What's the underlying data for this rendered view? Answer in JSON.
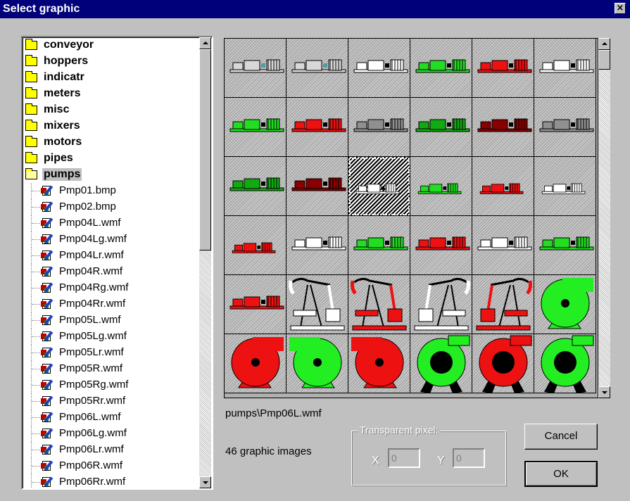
{
  "window": {
    "title": "Select graphic",
    "close_glyph": "×"
  },
  "tree": {
    "folders": [
      {
        "name": "conveyor",
        "open": false
      },
      {
        "name": "hoppers",
        "open": false
      },
      {
        "name": "indicatr",
        "open": false
      },
      {
        "name": "meters",
        "open": false
      },
      {
        "name": "misc",
        "open": false
      },
      {
        "name": "mixers",
        "open": false
      },
      {
        "name": "motors",
        "open": false
      },
      {
        "name": "pipes",
        "open": false
      },
      {
        "name": "pumps",
        "open": true,
        "selected": true
      }
    ],
    "files": [
      "Pmp01.bmp",
      "Pmp02.bmp",
      "Pmp04L.wmf",
      "Pmp04Lg.wmf",
      "Pmp04Lr.wmf",
      "Pmp04R.wmf",
      "Pmp04Rg.wmf",
      "Pmp04Rr.wmf",
      "Pmp05L.wmf",
      "Pmp05Lg.wmf",
      "Pmp05Lr.wmf",
      "Pmp05R.wmf",
      "Pmp05Rg.wmf",
      "Pmp05Rr.wmf",
      "Pmp06L.wmf",
      "Pmp06Lg.wmf",
      "Pmp06Lr.wmf",
      "Pmp06R.wmf",
      "Pmp06Rr.wmf"
    ],
    "file_icon": "bitmap-file-icon"
  },
  "gallery": {
    "cells": [
      {
        "kind": "pump",
        "color": "#d8d8d8",
        "accent": "#4aa0a0"
      },
      {
        "kind": "pump",
        "color": "#d8d8d8",
        "accent": "#4aa0a0"
      },
      {
        "kind": "pump",
        "color": "#ffffff",
        "accent": "#000000"
      },
      {
        "kind": "pump",
        "color": "#22dd22",
        "accent": "#000000"
      },
      {
        "kind": "pump",
        "color": "#ee1111",
        "accent": "#000000"
      },
      {
        "kind": "pump",
        "color": "#ffffff",
        "accent": "#000000"
      },
      {
        "kind": "pump",
        "color": "#22dd22",
        "accent": "#000000"
      },
      {
        "kind": "pump",
        "color": "#ee1111",
        "accent": "#000000"
      },
      {
        "kind": "pump",
        "color": "#909090",
        "accent": "#000000"
      },
      {
        "kind": "pump",
        "color": "#11aa11",
        "accent": "#000000"
      },
      {
        "kind": "pump",
        "color": "#880000",
        "accent": "#000000"
      },
      {
        "kind": "pump",
        "color": "#909090",
        "accent": "#000000"
      },
      {
        "kind": "pump",
        "color": "#11aa11",
        "accent": "#000000"
      },
      {
        "kind": "pump",
        "color": "#880000",
        "accent": "#000000"
      },
      {
        "kind": "small",
        "color": "#ffffff",
        "accent": "#000000",
        "selected": true
      },
      {
        "kind": "small",
        "color": "#22dd22",
        "accent": "#000000"
      },
      {
        "kind": "small",
        "color": "#ee1111",
        "accent": "#000000"
      },
      {
        "kind": "small",
        "color": "#ffffff",
        "accent": "#000000"
      },
      {
        "kind": "small",
        "color": "#ee1111",
        "accent": "#000000"
      },
      {
        "kind": "pump",
        "color": "#ffffff",
        "accent": "#000000"
      },
      {
        "kind": "pump",
        "color": "#22dd22",
        "accent": "#000000"
      },
      {
        "kind": "pump",
        "color": "#ee1111",
        "accent": "#000000"
      },
      {
        "kind": "pump",
        "color": "#ffffff",
        "accent": "#000000"
      },
      {
        "kind": "pump",
        "color": "#22dd22",
        "accent": "#000000"
      },
      {
        "kind": "pump",
        "color": "#ee1111",
        "accent": "#000000"
      },
      {
        "kind": "jack",
        "color": "#ffffff",
        "accent": "#000000"
      },
      {
        "kind": "jack",
        "color": "#ee1111",
        "accent": "#000000"
      },
      {
        "kind": "jackR",
        "color": "#ffffff",
        "accent": "#000000"
      },
      {
        "kind": "jackR",
        "color": "#ee1111",
        "accent": "#000000"
      },
      {
        "kind": "fan",
        "color": "#22ee22",
        "accent": "#000000"
      },
      {
        "kind": "fanL",
        "color": "#ee1111",
        "accent": "#000000"
      },
      {
        "kind": "fanR",
        "color": "#22ee22",
        "accent": "#000000"
      },
      {
        "kind": "fanR",
        "color": "#ee1111",
        "accent": "#000000"
      },
      {
        "kind": "fanBig",
        "color": "#22ee22",
        "accent": "#000000"
      },
      {
        "kind": "fanBig",
        "color": "#ee1111",
        "accent": "#000000"
      },
      {
        "kind": "fanBig",
        "color": "#22ee22",
        "accent": "#000000"
      }
    ]
  },
  "selection": {
    "path": "pumps\\Pmp06L.wmf",
    "count_text": "46 graphic images"
  },
  "transparent": {
    "label": "Transparent pixel:",
    "x_label": "X",
    "x_value": "0",
    "y_label": "Y",
    "y_value": "0"
  },
  "buttons": {
    "cancel": "Cancel",
    "ok": "OK"
  }
}
